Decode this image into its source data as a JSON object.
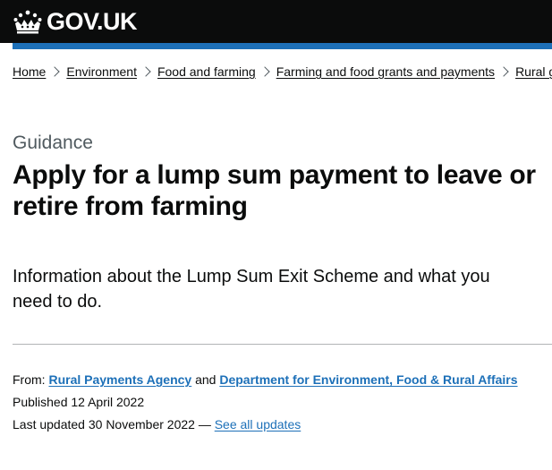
{
  "header": {
    "logo_text": "GOV.UK",
    "logo_icon": "crown-icon",
    "background_color": "#0b0c0c",
    "bar_color": "#1d70b8"
  },
  "breadcrumbs": [
    {
      "label": "Home"
    },
    {
      "label": "Environment"
    },
    {
      "label": "Food and farming"
    },
    {
      "label": "Farming and food grants and payments"
    },
    {
      "label": "Rural grants and payments"
    }
  ],
  "page": {
    "caption": "Guidance",
    "title": "Apply for a lump sum payment to leave or retire from farming",
    "lede": "Information about the Lump Sum Exit Scheme and what you need to do."
  },
  "metadata": {
    "from_label": "From:",
    "organisations": [
      "Rural Payments Agency",
      "Department for Environment, Food & Rural Affairs"
    ],
    "and_text": "and",
    "published_label": "Published",
    "published_date": "12 April 2022",
    "updated_label": "Last updated",
    "updated_date": "30 November 2022",
    "updated_separator": "—",
    "see_all_updates": "See all updates"
  },
  "colors": {
    "link": "#1d70b8",
    "text": "#0b0c0c",
    "secondary_text": "#505a5f"
  }
}
